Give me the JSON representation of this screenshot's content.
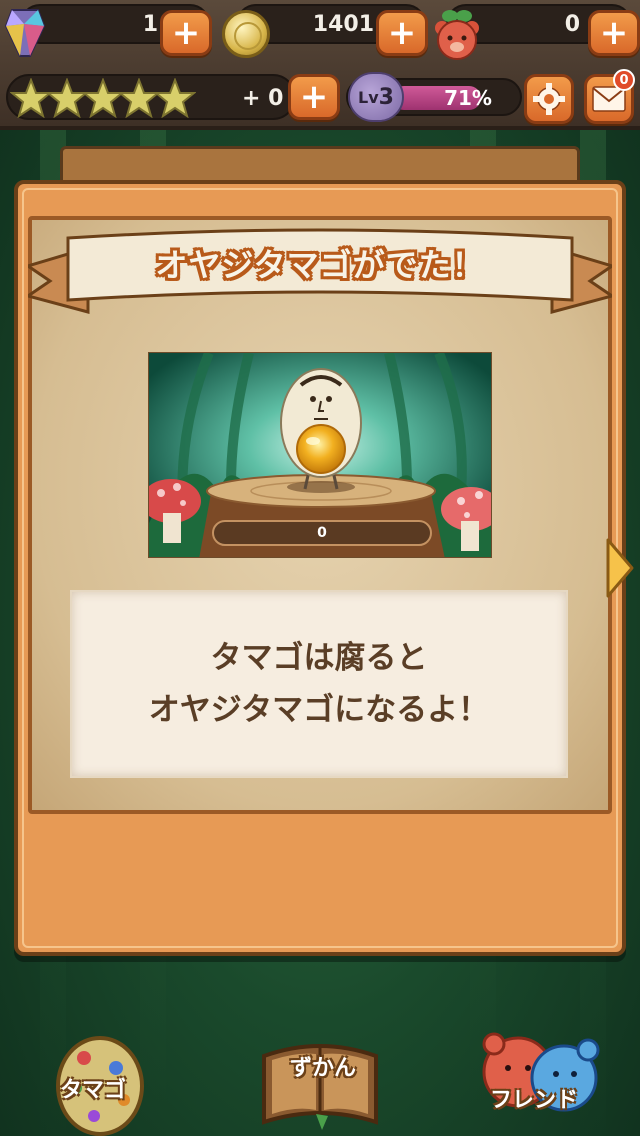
{
  "header": {
    "gems": "1",
    "coins": "1401",
    "bears": "0",
    "stars_bonus": "+ 0",
    "level_prefix": "Lv",
    "level": "3",
    "level_progress": "71%",
    "level_progress_value": 0.71,
    "mail_badge": "0",
    "plus_symbol": "+"
  },
  "dialog": {
    "title": "オヤジタマゴがでた！",
    "counter": "0",
    "message_line1": "タマゴは腐ると",
    "message_line2": "オヤジタマゴになるよ！"
  },
  "nav": {
    "egg_label": "タマゴ",
    "book_label": "ずかん",
    "friend_label": "フレンド"
  },
  "colors": {
    "accent_orange": "#e79a55",
    "button_orange": "#d9692a",
    "progress_pink": "#d05a98"
  },
  "icons": [
    "gem-icon",
    "coin-icon",
    "bear-icon",
    "star-icon",
    "gear-icon",
    "mail-icon",
    "next-arrow-icon",
    "egg-icon",
    "book-icon",
    "friend-icon"
  ]
}
